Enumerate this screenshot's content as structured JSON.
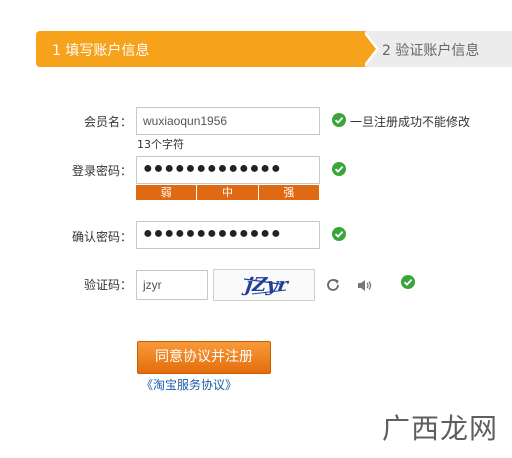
{
  "steps": {
    "step1": "1 填写账户信息",
    "step2": "2 验证账户信息"
  },
  "username": {
    "label": "会员名：",
    "value": "wuxiaoqun1956",
    "status": "一旦注册成功不能修改",
    "char_count": "13个字符"
  },
  "password": {
    "label": "登录密码：",
    "value": "●●●●●●●●●●●●●",
    "strength": [
      "弱",
      "中",
      "强"
    ]
  },
  "confirm": {
    "label": "确认密码：",
    "value": "●●●●●●●●●●●●●"
  },
  "captcha": {
    "label": "验证码：",
    "value": "jzyr",
    "image_text": "jZyr"
  },
  "actions": {
    "submit": "同意协议并注册",
    "agreement": "《淘宝服务协议》"
  },
  "watermark": "广西龙网",
  "colors": {
    "accent": "#f6a21a",
    "strength": "#e06a14",
    "ok": "#3aa63a",
    "link": "#1e5aa8"
  }
}
